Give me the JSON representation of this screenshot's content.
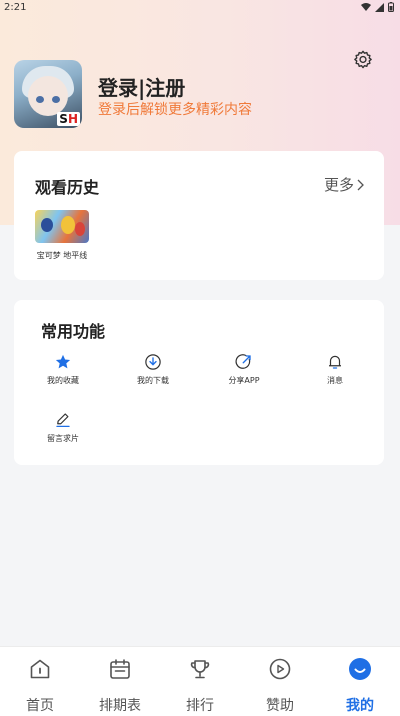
{
  "status_bar": {
    "time": "2:21"
  },
  "profile": {
    "login_label": "登录|注册",
    "login_hint": "登录后解锁更多精彩内容",
    "avatar_badge": {
      "s": "S",
      "h": "H"
    }
  },
  "history": {
    "title": "观看历史",
    "more_label": "更多",
    "items": [
      {
        "title": "宝可梦 地平线"
      }
    ]
  },
  "functions": {
    "title": "常用功能",
    "items": [
      {
        "label": "我的收藏",
        "icon": "star-icon"
      },
      {
        "label": "我的下载",
        "icon": "download-icon"
      },
      {
        "label": "分享APP",
        "icon": "share-icon"
      },
      {
        "label": "消息",
        "icon": "bell-icon"
      },
      {
        "label": "留言求片",
        "icon": "edit-icon"
      }
    ]
  },
  "tabs": [
    {
      "label": "首页",
      "icon": "home-icon"
    },
    {
      "label": "排期表",
      "icon": "calendar-icon"
    },
    {
      "label": "排行",
      "icon": "trophy-icon"
    },
    {
      "label": "赞助",
      "icon": "play-circle-icon"
    },
    {
      "label": "我的",
      "icon": "profile-icon",
      "active": true
    }
  ],
  "colors": {
    "accent": "#1f6fe5",
    "hint": "#f07a3a",
    "star": "#1f6fe5"
  }
}
